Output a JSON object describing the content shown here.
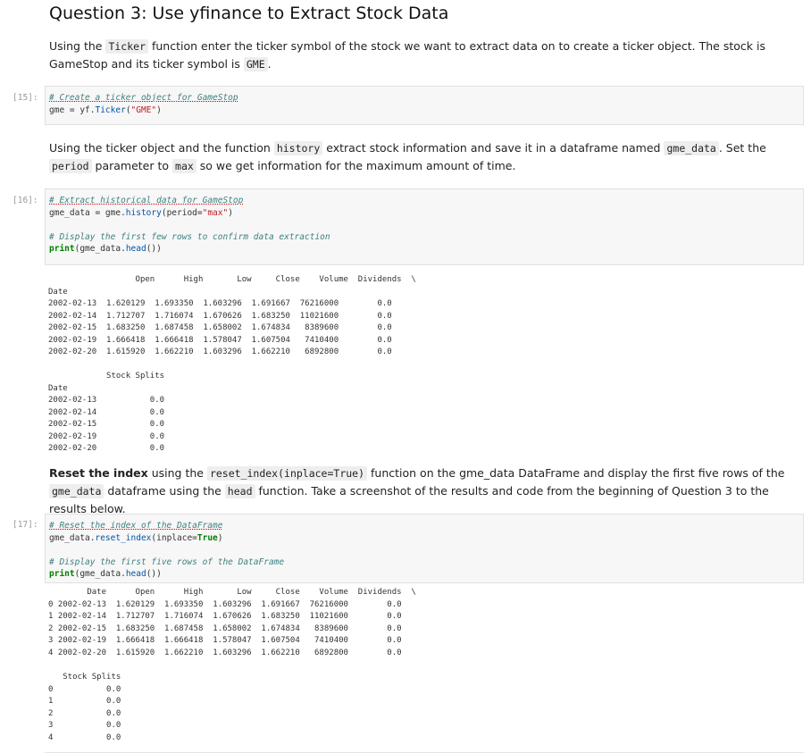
{
  "title": "Question 3: Use yfinance to Extract Stock Data",
  "intro": {
    "t1": "Using the ",
    "code1": "Ticker",
    "t2": " function enter the ticker symbol of the stock we want to extract data on to create a ticker object. The stock is GameStop and its ticker symbol is ",
    "code2": "GME",
    "t3": "."
  },
  "cell1": {
    "prompt": "[15]:",
    "comment": "# Create a ticker object for GameStop",
    "line2_a": "gme = yf.",
    "line2_fn": "Ticker",
    "line2_b": "(",
    "line2_str": "\"GME\"",
    "line2_c": ")"
  },
  "para2": {
    "t1": "Using the ticker object and the function ",
    "code1": "history",
    "t2": " extract stock information and save it in a dataframe named ",
    "code2": "gme_data",
    "t3": ". Set the ",
    "code3": "period",
    "t4": " parameter to ",
    "code4": "max",
    "t5": " so we get information for the maximum amount of time."
  },
  "cell2": {
    "prompt": "[16]:",
    "comment1": "# Extract historical data for GameStop",
    "line2_a": "gme_data = gme.",
    "line2_fn": "history",
    "line2_b": "(period=",
    "line2_str": "\"max\"",
    "line2_c": ")",
    "comment2": "# Display the first few rows to confirm data extraction",
    "line4_fn": "print",
    "line4_a": "(gme_data.",
    "line4_fn2": "head",
    "line4_b": "())"
  },
  "output1": {
    "table_a": "                  Open      High       Low     Close    Volume  Dividends  \\\nDate                                                                      \n2002-02-13  1.620129  1.693350  1.603296  1.691667  76216000        0.0   \n2002-02-14  1.712707  1.716074  1.670626  1.683250  11021600        0.0   \n2002-02-15  1.683250  1.687458  1.658002  1.674834   8389600        0.0   \n2002-02-19  1.666418  1.666418  1.578047  1.607504   7410400        0.0   \n2002-02-20  1.615920  1.662210  1.603296  1.662210   6892800        0.0   ",
    "table_b": "            Stock Splits  \nDate                      \n2002-02-13           0.0  \n2002-02-14           0.0  \n2002-02-15           0.0  \n2002-02-19           0.0  \n2002-02-20           0.0  "
  },
  "para3": {
    "bold": "Reset the index",
    "t1": " using the ",
    "code1": "reset_index(inplace=True)",
    "t2": " function on the gme_data DataFrame and display the first five rows of the ",
    "code2": "gme_data",
    "t3": " dataframe using the ",
    "code3": "head",
    "t4": " function. Take a screenshot of the results and code from the beginning of Question 3 to the results below."
  },
  "cell3": {
    "prompt": "[17]:",
    "comment1": "# Reset the index of the DataFrame",
    "line2_a": "gme_data.",
    "line2_fn": "reset_index",
    "line2_b": "(inplace=",
    "line2_kw": "True",
    "line2_c": ")",
    "comment2": "# Display the first five rows of the DataFrame",
    "line4_fn": "print",
    "line4_a": "(gme_data.",
    "line4_fn2": "head",
    "line4_b": "())"
  },
  "output2": {
    "table_a": "        Date      Open      High       Low     Close    Volume  Dividends  \\\n0 2002-02-13  1.620129  1.693350  1.603296  1.691667  76216000        0.0   \n1 2002-02-14  1.712707  1.716074  1.670626  1.683250  11021600        0.0   \n2 2002-02-15  1.683250  1.687458  1.658002  1.674834   8389600        0.0   \n3 2002-02-19  1.666418  1.666418  1.578047  1.607504   7410400        0.0   \n4 2002-02-20  1.615920  1.662210  1.603296  1.662210   6892800        0.0   ",
    "table_b": "   Stock Splits  \n0           0.0  \n1           0.0  \n2           0.0  \n3           0.0  \n4           0.0  "
  }
}
